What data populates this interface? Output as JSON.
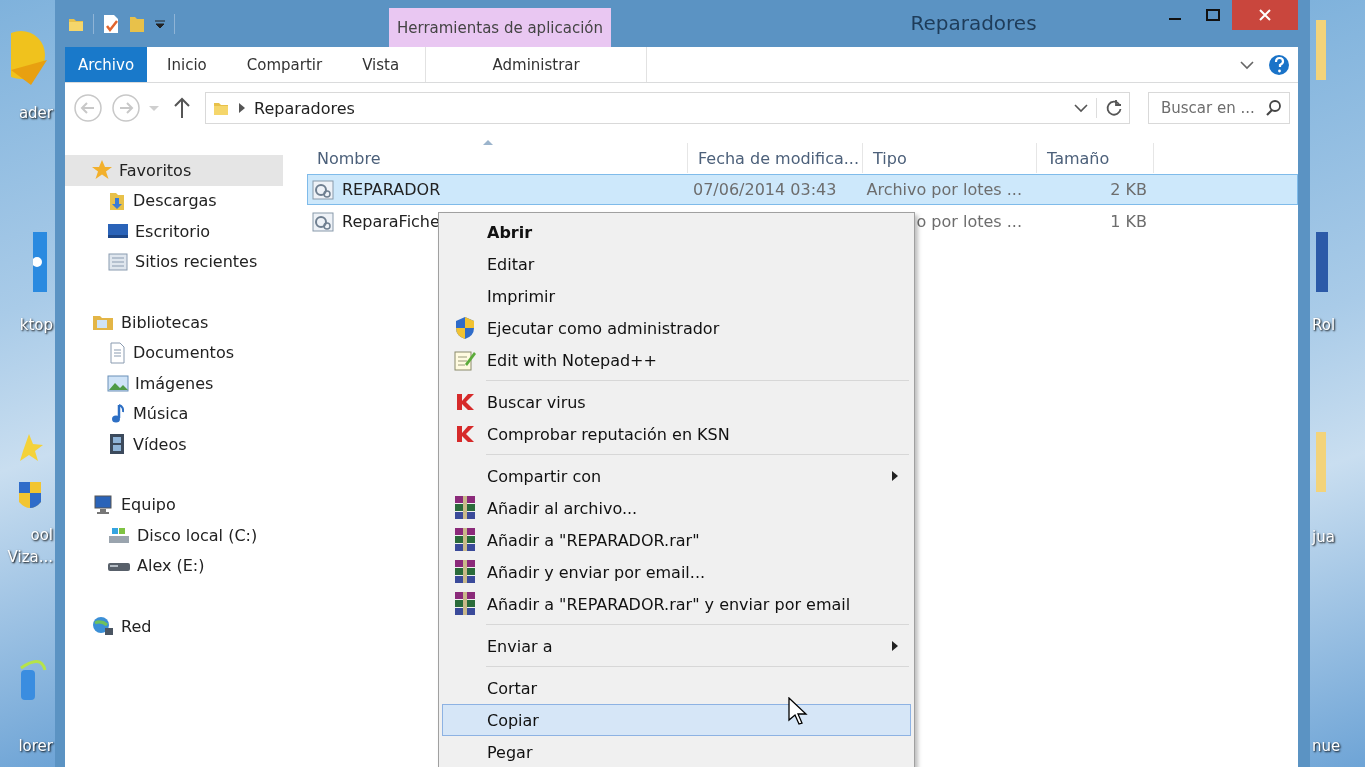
{
  "desktop": {
    "left_icons": [
      {
        "lines": [
          "ader"
        ]
      },
      {
        "lines": [
          "ktop"
        ]
      },
      {
        "lines": [
          "ool",
          "Viza..."
        ]
      },
      {
        "lines": [
          "lorer"
        ]
      }
    ],
    "right_icons": [
      {
        "lines": [
          "Rol"
        ]
      },
      {
        "lines": [
          "jua"
        ]
      },
      {
        "lines": [
          "nue"
        ]
      }
    ]
  },
  "window": {
    "title": "Reparadores",
    "context_tab": "Herramientas de aplicación",
    "ribbon_tabs": [
      {
        "label": "Archivo",
        "kind": "file",
        "selected": false
      },
      {
        "label": "Inicio",
        "kind": "tab",
        "selected": false
      },
      {
        "label": "Compartir",
        "kind": "tab",
        "selected": false
      },
      {
        "label": "Vista",
        "kind": "tab",
        "selected": false
      },
      {
        "label": "Administrar",
        "kind": "context",
        "selected": false
      }
    ],
    "address": {
      "path": "Reparadores"
    },
    "search": {
      "placeholder": "Buscar en ..."
    }
  },
  "sidebar": {
    "groups": [
      {
        "label": "Favoritos",
        "kind": "favorites",
        "selected": true,
        "children": [
          {
            "label": "Descargas",
            "kind": "downloads",
            "selected": false
          },
          {
            "label": "Escritorio",
            "kind": "desktop",
            "selected": false
          },
          {
            "label": "Sitios recientes",
            "kind": "recent",
            "selected": false
          }
        ]
      },
      {
        "label": "Bibliotecas",
        "kind": "libraries",
        "selected": false,
        "children": [
          {
            "label": "Documentos",
            "kind": "documents",
            "selected": false
          },
          {
            "label": "Imágenes",
            "kind": "pictures",
            "selected": false
          },
          {
            "label": "Música",
            "kind": "music",
            "selected": false
          },
          {
            "label": "Vídeos",
            "kind": "videos",
            "selected": false
          }
        ]
      },
      {
        "label": "Equipo",
        "kind": "computer",
        "selected": false,
        "children": [
          {
            "label": "Disco local (C:)",
            "kind": "disk",
            "selected": false
          },
          {
            "label": "Alex (E:)",
            "kind": "drive",
            "selected": false
          }
        ]
      },
      {
        "label": "Red",
        "kind": "network",
        "selected": false
      }
    ]
  },
  "table": {
    "columns": [
      "Nombre",
      "Fecha de modifica...",
      "Tipo",
      "Tamaño"
    ],
    "rows": [
      {
        "name": "REPARADOR",
        "date": "07/06/2014 03:43",
        "type": "Archivo por lotes ...",
        "size": "2 KB",
        "selected": true
      },
      {
        "name": "ReparaFiche",
        "type": "o por lotes ...",
        "size": "1 KB",
        "selected": false
      }
    ]
  },
  "context_menu": {
    "items": [
      {
        "kind": "plain",
        "label": "Abrir",
        "default": true,
        "submenu": false,
        "selected": false
      },
      {
        "kind": "plain",
        "label": "Editar",
        "default": false,
        "submenu": false,
        "selected": false
      },
      {
        "kind": "plain",
        "label": "Imprimir",
        "default": false,
        "submenu": false,
        "selected": false
      },
      {
        "kind": "admin",
        "label": "Ejecutar como administrador",
        "default": false,
        "submenu": false,
        "selected": false
      },
      {
        "kind": "notepad",
        "label": "Edit with Notepad++",
        "default": false,
        "submenu": false,
        "selected": false
      },
      {
        "kind": "separator"
      },
      {
        "kind": "antivirus",
        "label": "Buscar virus",
        "default": false,
        "submenu": false,
        "selected": false
      },
      {
        "kind": "antivirus",
        "label": "Comprobar reputación en KSN",
        "default": false,
        "submenu": false,
        "selected": false
      },
      {
        "kind": "separator"
      },
      {
        "kind": "plain",
        "label": "Compartir con",
        "default": false,
        "submenu": true,
        "selected": false
      },
      {
        "kind": "archive",
        "label": "Añadir al archivo...",
        "default": false,
        "submenu": false,
        "selected": false
      },
      {
        "kind": "archive",
        "label": "Añadir a \"REPARADOR.rar\"",
        "default": false,
        "submenu": false,
        "selected": false
      },
      {
        "kind": "archive",
        "label": "Añadir y enviar por email...",
        "default": false,
        "submenu": false,
        "selected": false
      },
      {
        "kind": "archive",
        "label": "Añadir a \"REPARADOR.rar\" y enviar por email",
        "default": false,
        "submenu": false,
        "selected": false
      },
      {
        "kind": "separator"
      },
      {
        "kind": "plain",
        "label": "Enviar a",
        "default": false,
        "submenu": true,
        "selected": false
      },
      {
        "kind": "separator"
      },
      {
        "kind": "plain",
        "label": "Cortar",
        "default": false,
        "submenu": false,
        "selected": false
      },
      {
        "kind": "plain",
        "label": "Copiar",
        "default": false,
        "submenu": false,
        "selected": true
      },
      {
        "kind": "plain",
        "label": "Pegar",
        "default": false,
        "submenu": false,
        "selected": false
      }
    ]
  }
}
